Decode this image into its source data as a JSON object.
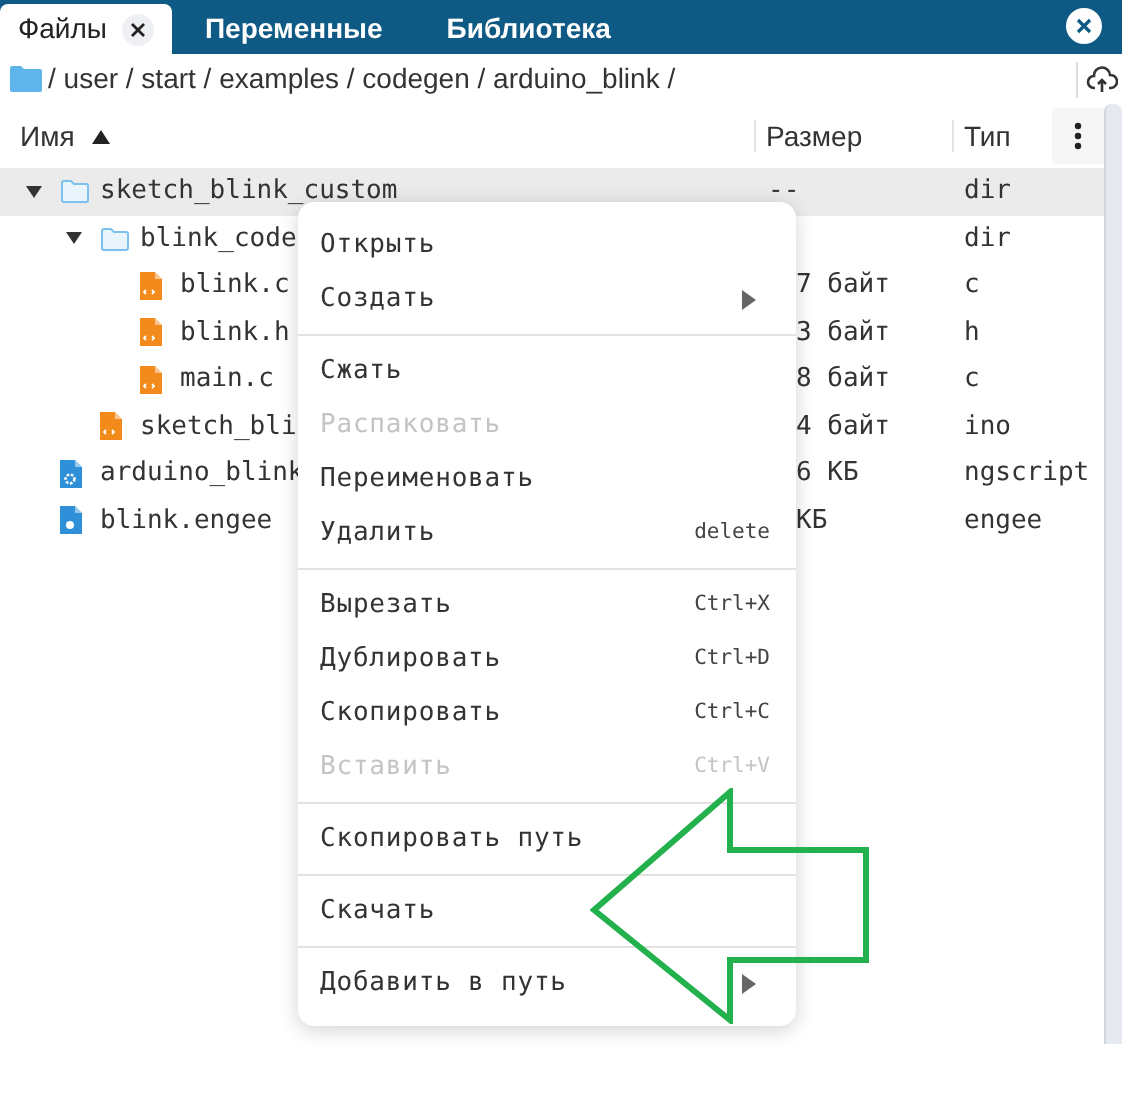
{
  "tabs": [
    {
      "label": "Файлы",
      "selected": true,
      "closable": true
    },
    {
      "label": "Переменные",
      "selected": false,
      "closable": false
    },
    {
      "label": "Библиотека",
      "selected": false,
      "closable": false
    }
  ],
  "path": "/ user / start / examples / codegen / arduino_blink /",
  "columns": [
    {
      "label": "Имя",
      "sort_ascending": true
    },
    {
      "label": "Размер"
    },
    {
      "label": "Тип"
    }
  ],
  "tree": [
    {
      "name": "sketch_blink_custom",
      "kind": "folder",
      "expanded": true,
      "selected": true,
      "size": "--",
      "type": "dir",
      "children": [
        {
          "name": "blink_code",
          "kind": "folder",
          "expanded": true,
          "selected": false,
          "type": "dir",
          "children": [
            {
              "name": "blink.c",
              "kind": "code",
              "selected": false,
              "size": "7 байт",
              "type": "c"
            },
            {
              "name": "blink.h",
              "kind": "code",
              "selected": false,
              "size": "3 байт",
              "type": "h"
            },
            {
              "name": "main.c",
              "kind": "code",
              "selected": false,
              "size": "8 байт",
              "type": "c"
            }
          ]
        },
        {
          "name": "sketch_bli",
          "kind": "code",
          "selected": false,
          "size": "4 байт",
          "type": "ino"
        }
      ]
    },
    {
      "name": "arduino_blink",
      "kind": "script",
      "selected": false,
      "size": "6 КБ",
      "type": "ngscript"
    },
    {
      "name": "blink.engee",
      "kind": "model",
      "selected": false,
      "size": "КБ",
      "type": "engee"
    }
  ],
  "menu": [
    [
      {
        "label": "Открыть",
        "disabled": false
      },
      {
        "label": "Создать",
        "disabled": false,
        "submenu": true
      }
    ],
    [
      {
        "label": "Сжать",
        "disabled": false
      },
      {
        "label": "Распаковать",
        "disabled": true
      },
      {
        "label": "Переименовать",
        "disabled": false
      },
      {
        "label": "Удалить",
        "disabled": false,
        "shortcut": "delete"
      }
    ],
    [
      {
        "label": "Вырезать",
        "disabled": false,
        "shortcut": "Ctrl+X"
      },
      {
        "label": "Дублировать",
        "disabled": false,
        "shortcut": "Ctrl+D"
      },
      {
        "label": "Скопировать",
        "disabled": false,
        "shortcut": "Ctrl+C"
      },
      {
        "label": "Вставить",
        "disabled": true,
        "shortcut": "Ctrl+V"
      }
    ],
    [
      {
        "label": "Скопировать путь",
        "disabled": false
      }
    ],
    [
      {
        "label": "Скачать",
        "disabled": false
      }
    ],
    [
      {
        "label": "Добавить в путь",
        "disabled": false,
        "submenu": true
      }
    ]
  ]
}
